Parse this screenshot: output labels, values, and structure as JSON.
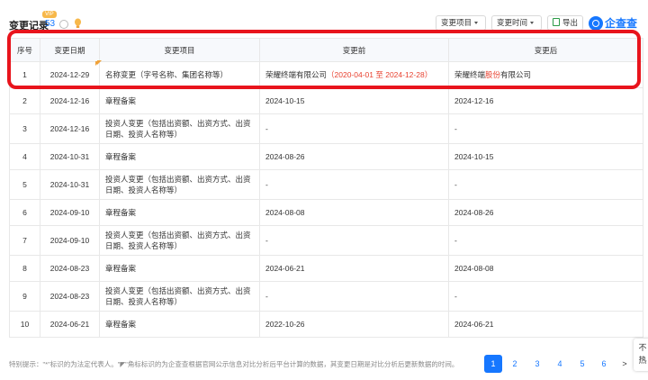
{
  "header": {
    "title": "变更记录",
    "count": "53",
    "vip": "VIP",
    "item_button": "变更项目",
    "time_button": "变更时间",
    "export_button": "导出",
    "logo_text": "企查查"
  },
  "table": {
    "columns": [
      "序号",
      "变更日期",
      "变更项目",
      "变更前",
      "变更后"
    ],
    "rows": [
      {
        "no": "1",
        "date": "2024-12-29",
        "item": "名称变更（字号名称、集团名称等）",
        "before": "荣耀终端有限公司",
        "before_note": "（2020-04-01 至 2024-12-28）",
        "after_a": "荣耀终端",
        "after_hl": "股份",
        "after_b": "有限公司"
      },
      {
        "no": "2",
        "date": "2024-12-16",
        "item": "章程备案",
        "before": "2024-10-15",
        "after": "2024-12-16"
      },
      {
        "no": "3",
        "date": "2024-12-16",
        "item": "投资人变更（包括出资额、出资方式、出资日期、投资人名称等）",
        "before": "-",
        "after": "-"
      },
      {
        "no": "4",
        "date": "2024-10-31",
        "item": "章程备案",
        "before": "2024-08-26",
        "after": "2024-10-15"
      },
      {
        "no": "5",
        "date": "2024-10-31",
        "item": "投资人变更（包括出资额、出资方式、出资日期、投资人名称等）",
        "before": "-",
        "after": "-"
      },
      {
        "no": "6",
        "date": "2024-09-10",
        "item": "章程备案",
        "before": "2024-08-08",
        "after": "2024-08-26"
      },
      {
        "no": "7",
        "date": "2024-09-10",
        "item": "投资人变更（包括出资额、出资方式、出资日期、投资人名称等）",
        "before": "-",
        "after": "-"
      },
      {
        "no": "8",
        "date": "2024-08-23",
        "item": "章程备案",
        "before": "2024-06-21",
        "after": "2024-08-08"
      },
      {
        "no": "9",
        "date": "2024-08-23",
        "item": "投资人变更（包括出资额、出资方式、出资日期、投资人名称等）",
        "before": "-",
        "after": "-"
      },
      {
        "no": "10",
        "date": "2024-06-21",
        "item": "章程备案",
        "before": "2022-10-26",
        "after": "2024-06-21"
      }
    ]
  },
  "footer": {
    "note": "特别提示：\"*\"标识的为法定代表人。\"◤\"角标标识的为企查查根据官网公示信息对比分析后平台计算的数据，其变更日期是对比分析后更新数据的时间。",
    "pages": [
      "1",
      "2",
      "3",
      "4",
      "5",
      "6"
    ],
    "next": ">",
    "active_page": "1"
  },
  "side_widget": {
    "line1": "不",
    "line2": "热"
  },
  "colors": {
    "accent": "#1677ff",
    "highlight_border": "#e8141c",
    "change_red": "#e8412f"
  }
}
